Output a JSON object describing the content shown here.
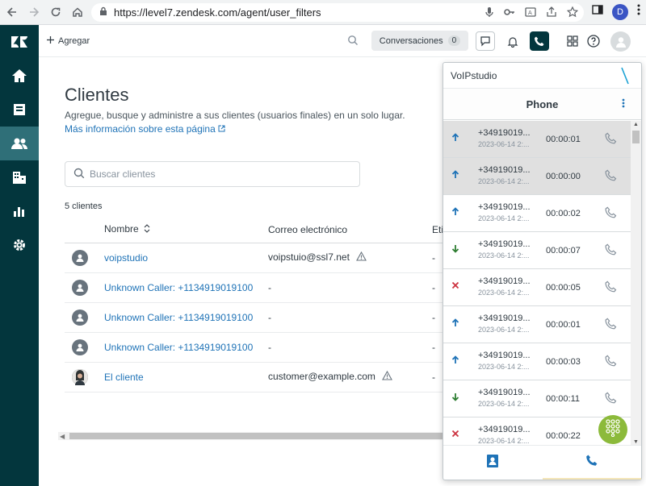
{
  "browser": {
    "url": "https://level7.zendesk.com/agent/user_filters",
    "profile_initial": "D"
  },
  "topbar": {
    "add_label": "Agregar",
    "conversations_label": "Conversaciones",
    "conversations_count": "0"
  },
  "page": {
    "title": "Clientes",
    "description": "Agregue, busque y administre a sus clientes (usuarios finales) en un solo lugar.",
    "more_info_link": "Más información sobre esta página",
    "search_placeholder": "Buscar clientes",
    "count_label": "5 clientes"
  },
  "table": {
    "headers": [
      "Nombre",
      "Correo electrónico",
      "Eti"
    ],
    "rows": [
      {
        "name": "voipstudio",
        "email": "voipstuio@ssl7.net",
        "tag": "-",
        "avatar": "default",
        "warn": true
      },
      {
        "name": "Unknown Caller: +1134919019100",
        "email": "-",
        "tag": "-",
        "avatar": "default",
        "warn": false
      },
      {
        "name": "Unknown Caller: +1134919019100",
        "email": "-",
        "tag": "-",
        "avatar": "default",
        "warn": false
      },
      {
        "name": "Unknown Caller: +1134919019100",
        "email": "-",
        "tag": "-",
        "avatar": "default",
        "warn": false
      },
      {
        "name": "El cliente",
        "email": "customer@example.com",
        "tag": "-",
        "avatar": "photo",
        "warn": true
      }
    ]
  },
  "voip": {
    "title": "VoIPstudio",
    "phone_title": "Phone",
    "calls": [
      {
        "number": "+34919019...",
        "date": "2023-06-14 2:...",
        "duration": "00:00:01",
        "direction": "outgoing",
        "highlight": true
      },
      {
        "number": "+34919019...",
        "date": "2023-06-14 2:...",
        "duration": "00:00:00",
        "direction": "outgoing",
        "highlight": true
      },
      {
        "number": "+34919019...",
        "date": "2023-06-14 2:...",
        "duration": "00:00:02",
        "direction": "outgoing",
        "highlight": false
      },
      {
        "number": "+34919019...",
        "date": "2023-06-14 2:...",
        "duration": "00:00:07",
        "direction": "incoming",
        "highlight": false
      },
      {
        "number": "+34919019...",
        "date": "2023-06-14 2:...",
        "duration": "00:00:05",
        "direction": "missed",
        "highlight": false
      },
      {
        "number": "+34919019...",
        "date": "2023-06-14 2:...",
        "duration": "00:00:01",
        "direction": "outgoing",
        "highlight": false
      },
      {
        "number": "+34919019...",
        "date": "2023-06-14 2:...",
        "duration": "00:00:03",
        "direction": "outgoing",
        "highlight": false
      },
      {
        "number": "+34919019...",
        "date": "2023-06-14 2:...",
        "duration": "00:00:11",
        "direction": "incoming",
        "highlight": false
      },
      {
        "number": "+34919019...",
        "date": "2023-06-14 2:...",
        "duration": "00:00:22",
        "direction": "missed",
        "highlight": false
      }
    ]
  },
  "colors": {
    "sidebar": "#03363d",
    "link": "#1f73b7",
    "outgoing": "#1f73b7",
    "incoming": "#2e7d32",
    "missed": "#cc3340",
    "dialpad": "#8cba3b"
  }
}
